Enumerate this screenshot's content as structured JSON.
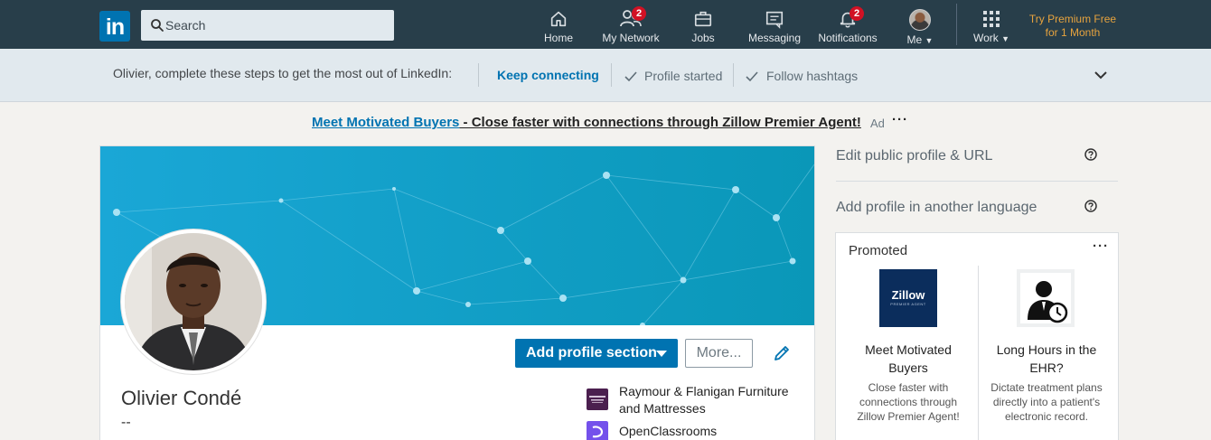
{
  "nav": {
    "logo_text": "in",
    "search_placeholder": "Search",
    "items": [
      {
        "label": "Home",
        "icon": "home-icon"
      },
      {
        "label": "My Network",
        "icon": "network-icon",
        "badge": "2"
      },
      {
        "label": "Jobs",
        "icon": "briefcase-icon"
      },
      {
        "label": "Messaging",
        "icon": "messaging-icon"
      },
      {
        "label": "Notifications",
        "icon": "bell-icon",
        "badge": "2"
      },
      {
        "label": "Me",
        "icon": "avatar"
      },
      {
        "label": "Work",
        "icon": "grid-icon"
      }
    ],
    "premium_line1": "Try Premium Free",
    "premium_line2": "for 1 Month"
  },
  "steps": {
    "intro": "Olivier, complete these steps to get the most out of LinkedIn:",
    "active": "Keep connecting",
    "done": [
      "Profile started",
      "Follow hashtags"
    ]
  },
  "ad": {
    "link": "Meet Motivated Buyers",
    "rest": " - Close faster with connections through Zillow Premier Agent!",
    "tag": "Ad",
    "more": "···"
  },
  "profile": {
    "name": "Olivier Condé",
    "headline": "--",
    "add_section_label": "Add profile section",
    "more_label": "More...",
    "companies": [
      {
        "name": "Raymour & Flanigan Furniture and Mattresses"
      },
      {
        "name": "OpenClassrooms"
      }
    ]
  },
  "rail": {
    "edit_public_profile": "Edit public profile & URL",
    "add_language": "Add profile in another language"
  },
  "promoted": {
    "title": "Promoted",
    "more": "···",
    "ads": [
      {
        "logo_text": "Zillow",
        "logo_sub": "PREMIER AGENT",
        "title": "Meet Motivated Buyers",
        "desc": "Close faster with connections through Zillow Premier Agent!"
      },
      {
        "title": "Long Hours in the EHR?",
        "desc": "Dictate treatment plans directly into a patient's electronic record."
      }
    ]
  },
  "colors": {
    "nav_bg": "#283e4a",
    "brand_blue": "#0073b1",
    "badge_red": "#d11124",
    "premium_gold": "#e7a33e"
  }
}
